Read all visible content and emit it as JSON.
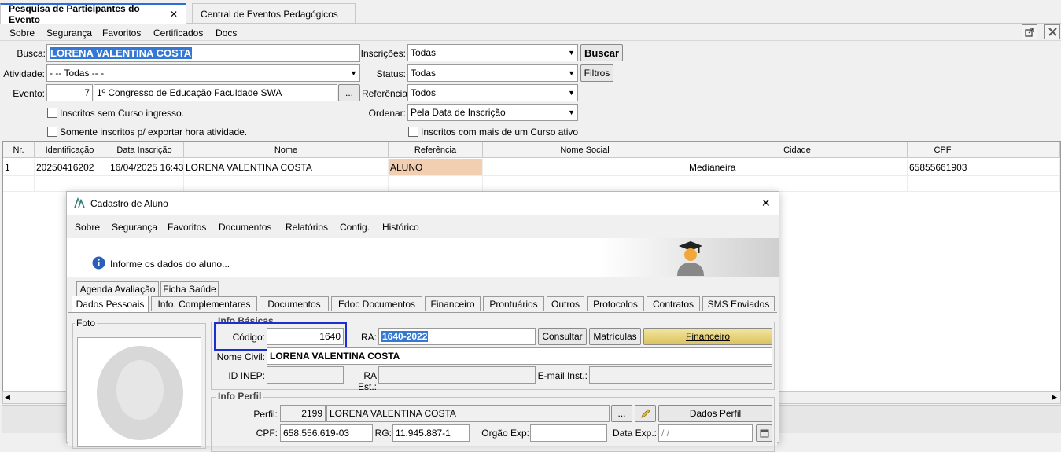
{
  "doc_tabs": [
    {
      "label": "Pesquisa de Participantes do Evento",
      "close": "✕"
    },
    {
      "label": "Central de Eventos Pedagógicos"
    }
  ],
  "menu": [
    "Sobre",
    "Segurança",
    "Favoritos",
    "Certificados",
    "Docs"
  ],
  "search": {
    "busca_label": "Busca:",
    "busca_value": "LORENA VALENTINA COSTA",
    "atividade_label": "Atividade:",
    "atividade_value": "- -- Todas -- -",
    "evento_label": "Evento:",
    "evento_id": "7",
    "evento_name": "1º Congresso de Educação Faculdade SWA",
    "evento_btn": "...",
    "chk1": "Inscritos sem Curso ingresso.",
    "chk2": "Somente inscritos p/ exportar hora atividade.",
    "inscricoes_label": "Inscrições:",
    "inscricoes_value": "Todas",
    "status_label": "Status:",
    "status_value": "Todas",
    "referencia_label": "Referência",
    "referencia_value": "Todos",
    "ordenar_label": "Ordenar:",
    "ordenar_value": "Pela Data de Inscrição",
    "chk3": "Inscritos com mais de um Curso ativo",
    "buscar_btn": "Buscar",
    "filtros_btn": "Filtros"
  },
  "grid": {
    "headers": [
      "Nr.",
      "Identificação",
      "Data Inscrição",
      "Nome",
      "Referência",
      "Nome Social",
      "Cidade",
      "CPF"
    ],
    "rows": [
      [
        "1",
        "20250416202",
        "16/04/2025 16:43",
        "LORENA VALENTINA COSTA",
        "ALUNO",
        "",
        "Medianeira",
        "65855661903"
      ]
    ],
    "highlight_color": "#f2cfb1"
  },
  "dialog": {
    "title": "Cadastro de Aluno",
    "close": "✕",
    "menu": [
      "Sobre",
      "Segurança",
      "Favoritos",
      "Documentos",
      "Relatórios",
      "Config.",
      "Histórico"
    ],
    "info": "Informe os dados do aluno...",
    "tabs_row1": [
      "Agenda Avaliação",
      "Ficha Saúde"
    ],
    "tabs_row2": [
      "Dados Pessoais",
      "Info. Complementares",
      "Documentos",
      "Edoc Documentos",
      "Financeiro",
      "Prontuários",
      "Outros",
      "Protocolos",
      "Contratos",
      "SMS Enviados"
    ],
    "foto_label": "Foto",
    "info_basicas": "Info Básicas",
    "codigo_label": "Código:",
    "codigo_value": "1640",
    "ra_label": "RA:",
    "ra_value": "1640-2022",
    "consultar_btn": "Consultar",
    "matriculas_btn": "Matrículas",
    "financeiro_btn": "Financeiro",
    "nome_civil_label": "Nome Civil:",
    "nome_civil_value": "LORENA VALENTINA COSTA",
    "id_inep_label": "ID INEP:",
    "ra_est_label": "RA Est.:",
    "email_label": "E-mail Inst.:",
    "info_perfil": "Info Perfil",
    "perfil_label": "Perfil:",
    "perfil_id": "2199",
    "perfil_name": "LORENA VALENTINA COSTA",
    "perfil_btn": "...",
    "dados_perfil_btn": "Dados Perfil",
    "cpf_label": "CPF:",
    "cpf_value": "658.556.619-03",
    "rg_label": "RG:",
    "rg_value": "11.945.887-1",
    "orgao_label": "Orgão Exp:",
    "data_exp_label": "Data Exp.:",
    "data_exp_value": "/ /"
  },
  "colors": {
    "accent": "#2b6fd6",
    "selection": "#3478d4",
    "highlight_box": "#1c2fd1",
    "financeiro_btn": "#e5d27a"
  }
}
